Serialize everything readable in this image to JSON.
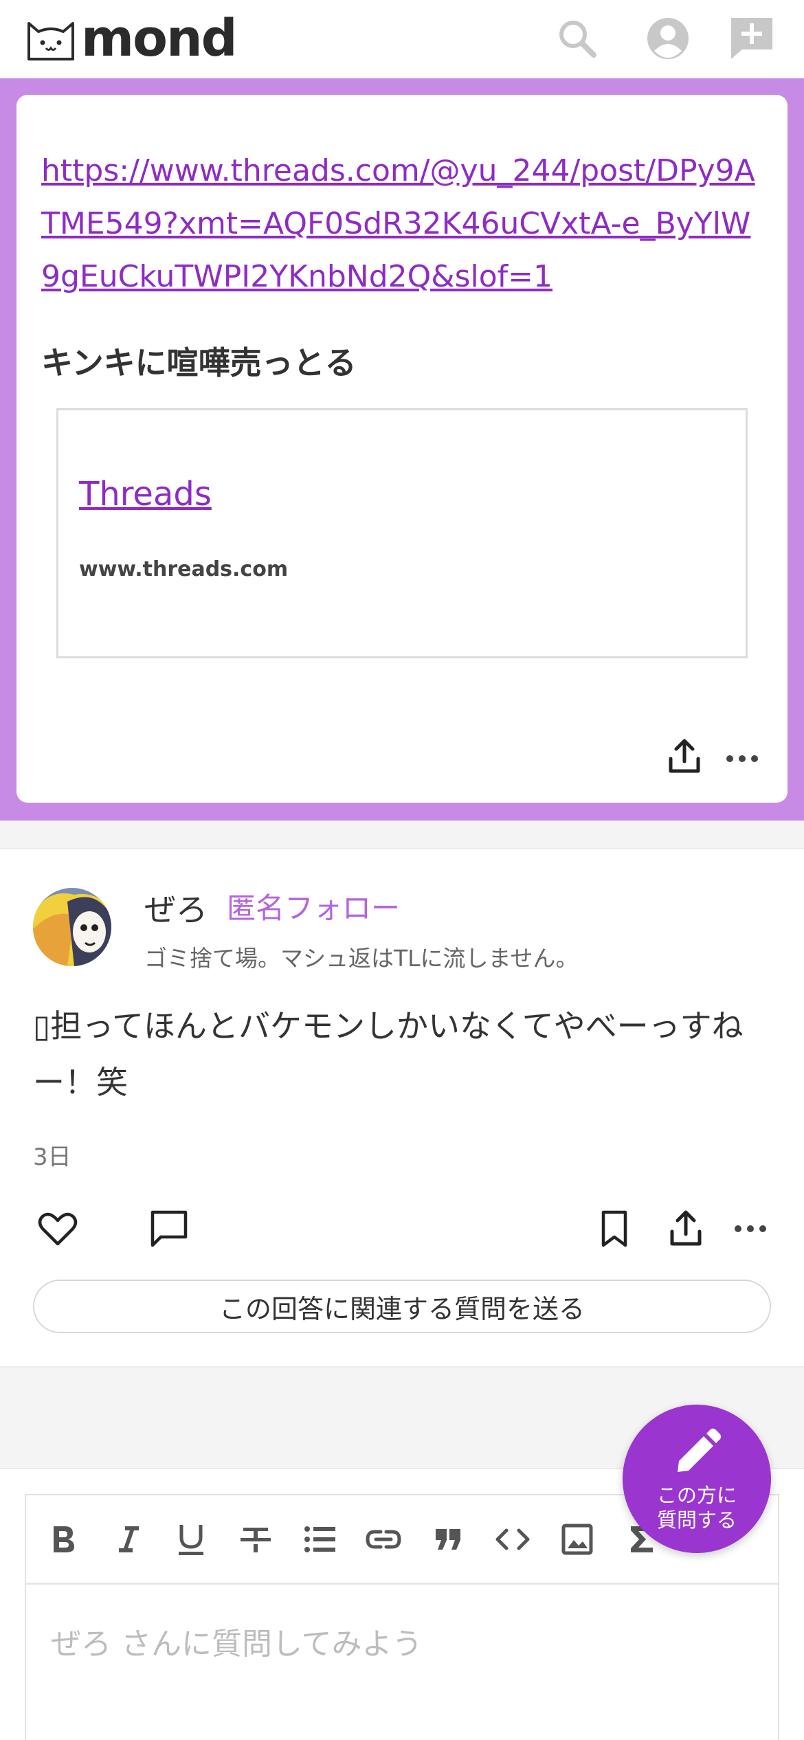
{
  "header": {
    "logo_text": "mond",
    "icons": [
      "search-icon",
      "account-icon",
      "new-question-icon"
    ]
  },
  "question": {
    "url": "https://www.threads.com/@yu_244/post/DPy9ATME549?xmt=AQF0SdR32K46uCVxtA-e_ByYlW9gEuCkuTWPI2YKnbNd2Q&slof=1",
    "text": "キンキに喧嘩売っとる",
    "link_card": {
      "title": "Threads",
      "domain": "www.threads.com"
    }
  },
  "answer": {
    "user_name": "ぜろ",
    "follow_label": "匿名フォロー",
    "bio": "ゴミ捨て場。マシュ返はTLに流しません。",
    "body": "▯担ってほんとバケモンしかいなくてやべーっすねー！笑",
    "date": "3日",
    "related_question_button": "この回答に関連する質問を送る"
  },
  "editor": {
    "toolbar": [
      "bold",
      "italic",
      "underline",
      "strikethrough",
      "bullet-list",
      "link",
      "quote",
      "code",
      "image",
      "formula"
    ],
    "placeholder": "ぜろ さんに質問してみよう"
  },
  "fab": {
    "label_line1": "この方に",
    "label_line2": "質問する"
  },
  "colors": {
    "accent": "#9a35cf",
    "band": "#c78be6",
    "link": "#8e2bc6"
  }
}
